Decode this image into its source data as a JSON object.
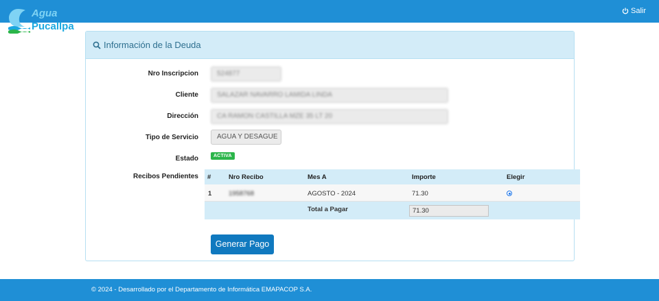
{
  "brand": {
    "line1": "Agua",
    "line2": "Pucallpa"
  },
  "nav": {
    "logout_label": "Salir"
  },
  "panel": {
    "title": "Información de la Deuda"
  },
  "fields": {
    "nro_inscripcion": {
      "label": "Nro Inscripcion",
      "value": "524877"
    },
    "cliente": {
      "label": "Cliente",
      "value": "SALAZAR NAVARRO LAMIDA LINDA"
    },
    "direccion": {
      "label": "Dirección",
      "value": "CA RAMON CASTILLA MZE 35 LT 20"
    },
    "tipo_servicio": {
      "label": "Tipo de Servicio",
      "value": "AGUA Y DESAGUE"
    },
    "estado": {
      "label": "Estado",
      "value": "ACTIVA"
    },
    "recibos": {
      "label": "Recibos Pendientes"
    }
  },
  "table": {
    "headers": [
      "#",
      "Nro Recibo",
      "Mes A",
      "Importe",
      "Elegir"
    ],
    "rows": [
      {
        "index": "1",
        "nro_recibo": "1958768",
        "mes": "AGOSTO - 2024",
        "importe": "71.30"
      }
    ],
    "total_label": "Total a Pagar",
    "total_value": "71.30"
  },
  "actions": {
    "generate_label": "Generar Pago"
  },
  "footer": {
    "text": "© 2024 - Desarrollado por el Departamento de Informática EMAPACOP S.A."
  },
  "colors": {
    "navbar": "#1f8fd6",
    "panel_heading": "#d3ecf8",
    "badge": "#2bb54a",
    "button": "#1079bf"
  }
}
